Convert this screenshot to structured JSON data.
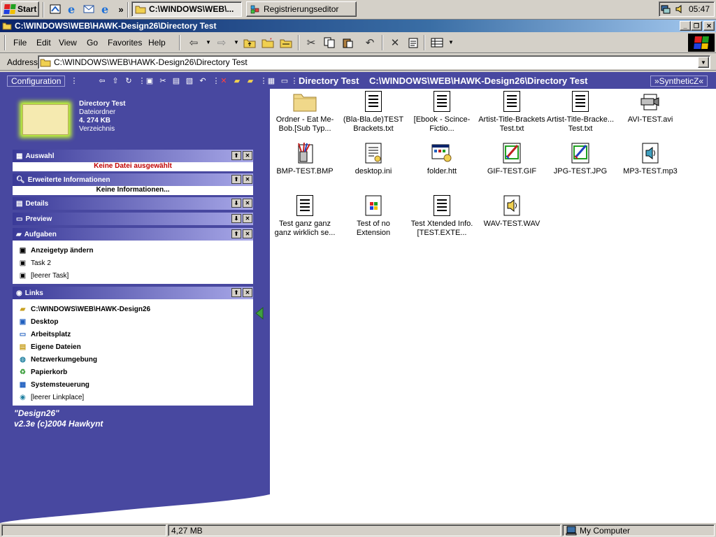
{
  "taskbar": {
    "start_label": "Start",
    "tasks": [
      {
        "label": "C:\\WINDOWS\\WEB\\...",
        "active": true
      },
      {
        "label": "Registrierungseditor",
        "active": false
      }
    ],
    "quicklaunch_overflow": "»",
    "clock": "05:47"
  },
  "window": {
    "title": "C:\\WINDOWS\\WEB\\HAWK-Design26\\Directory Test",
    "minimize_glyph": "_",
    "maximize_glyph": "❐",
    "close_glyph": "✕"
  },
  "menu": {
    "file": "File",
    "edit": "Edit",
    "view": "View",
    "go": "Go",
    "favorites": "Favorites",
    "help": "Help"
  },
  "address": {
    "label": "Address",
    "value": "C:\\WINDOWS\\WEB\\HAWK-Design26\\Directory Test"
  },
  "header": {
    "config_label": "Configuration",
    "title": "Directory Test",
    "path": "C:\\WINDOWS\\WEB\\HAWK-Design26\\Directory Test",
    "synth_label": "»SyntheticZ«"
  },
  "folder_info": {
    "name": "Directory Test",
    "type": "Dateiordner",
    "size": "4. 274 KB",
    "kind": "Verzeichnis"
  },
  "panels": {
    "auswahl": {
      "title": "Auswahl",
      "text": "Keine Datei ausgewählt"
    },
    "erweitert": {
      "title": "Erweiterte Informationen",
      "text": "Keine Informationen..."
    },
    "details": {
      "title": "Details"
    },
    "preview": {
      "title": "Preview"
    },
    "aufgaben": {
      "title": "Aufgaben",
      "items": [
        "Anzeigetyp ändern",
        "Task 2",
        "[leerer Task]"
      ]
    },
    "links": {
      "title": "Links",
      "items": [
        "C:\\WINDOWS\\WEB\\HAWK-Design26",
        "Desktop",
        "Arbeitsplatz",
        "Eigene Dateien",
        "Netzwerkumgebung",
        "Papierkorb",
        "Systemsteuerung",
        "[leerer Linkplace]"
      ]
    }
  },
  "credits": {
    "line1": "\"Design26\"",
    "line2": "v2.3e (c)2004 Hawkynt"
  },
  "files": [
    {
      "name": "Ordner - Eat Me-Bob.[Sub Typ...",
      "icon": "folder-icon"
    },
    {
      "name": "(Bla-Bla.de)TEST Brackets.txt",
      "icon": "text-file-icon"
    },
    {
      "name": "[Ebook - Scince-Fictio...",
      "icon": "text-file-icon"
    },
    {
      "name": "Artist-Title-Brackets Test.txt",
      "icon": "text-file-icon"
    },
    {
      "name": "Artist-Title-Bracke... Test.txt",
      "icon": "text-file-icon"
    },
    {
      "name": "AVI-TEST.avi",
      "icon": "video-file-icon"
    },
    {
      "name": "BMP-TEST.BMP",
      "icon": "paint-file-icon"
    },
    {
      "name": "desktop.ini",
      "icon": "settings-file-icon"
    },
    {
      "name": "folder.htt",
      "icon": "htt-file-icon"
    },
    {
      "name": "GIF-TEST.GIF",
      "icon": "image-file-icon"
    },
    {
      "name": "JPG-TEST.JPG",
      "icon": "image-file-icon"
    },
    {
      "name": "MP3-TEST.mp3",
      "icon": "audio-file-icon"
    },
    {
      "name": "Test ganz ganz ganz wirklich se...",
      "icon": "text-file-icon"
    },
    {
      "name": "Test of no Extension",
      "icon": "unknown-file-icon"
    },
    {
      "name": "Test Xtended Info.[TEST.EXTE...",
      "icon": "text-file-icon"
    },
    {
      "name": "WAV-TEST.WAV",
      "icon": "audio-file-icon"
    }
  ],
  "status": {
    "size": "4,27 MB",
    "zone": "My Computer"
  },
  "colors": {
    "sidebar": "#4848a0",
    "titlebar": "#0a246a",
    "alert_text": "#c00000"
  }
}
